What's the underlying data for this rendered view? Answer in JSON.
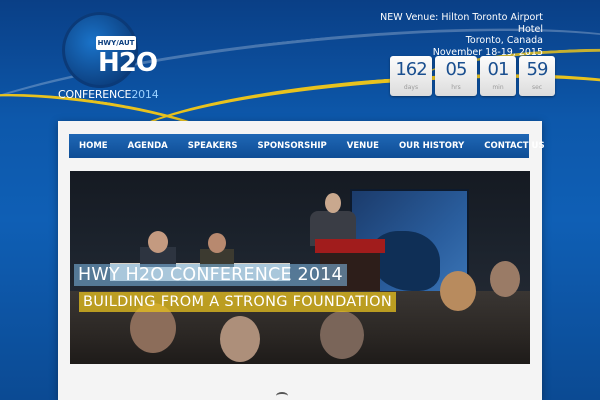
{
  "logo": {
    "badge": "HWY/AUT",
    "mark": "H2O",
    "conference_word": "CONFERENCE",
    "conference_year": "2014"
  },
  "venue": {
    "line1": "NEW Venue: Hilton Toronto Airport",
    "line2": "Hotel",
    "line3": "Toronto, Canada",
    "line4": "November 18-19, 2015"
  },
  "countdown": [
    {
      "value": "162",
      "unit": "days"
    },
    {
      "value": "05",
      "unit": "hrs"
    },
    {
      "value": "01",
      "unit": "min"
    },
    {
      "value": "59",
      "unit": "sec"
    }
  ],
  "nav": {
    "items": [
      "HOME",
      "AGENDA",
      "SPEAKERS",
      "SPONSORSHIP",
      "VENUE",
      "OUR HISTORY",
      "CONTACT US"
    ]
  },
  "hero": {
    "title": "HWY H2O CONFERENCE 2014",
    "subtitle": "BUILDING FROM A STRONG FOUNDATION"
  }
}
